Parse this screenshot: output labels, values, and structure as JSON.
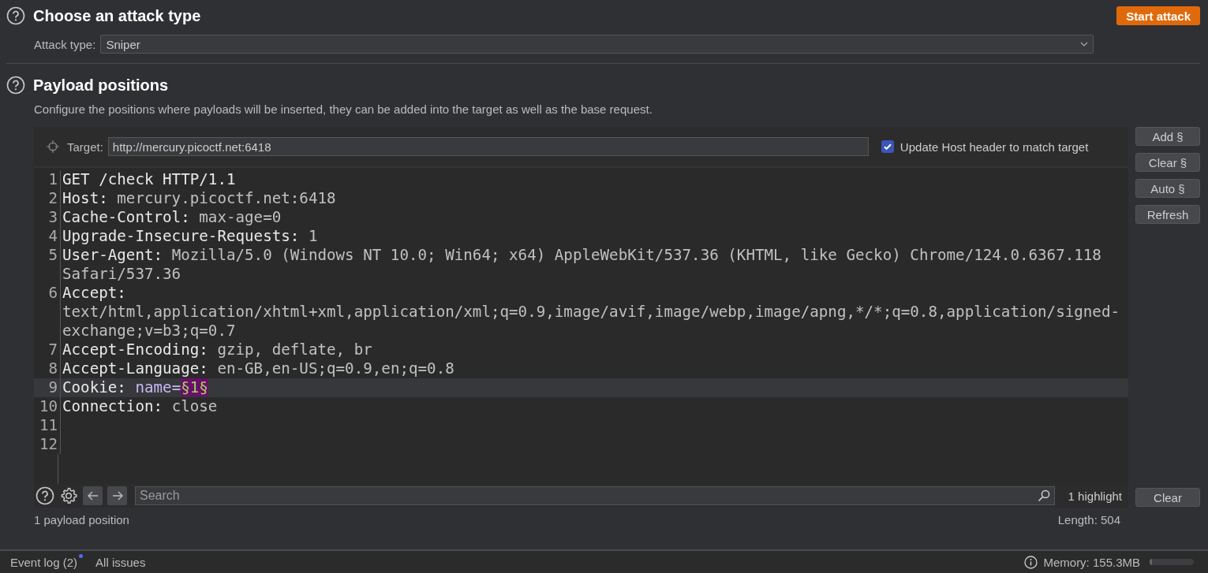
{
  "attack_section": {
    "title": "Choose an attack type",
    "start_button": "Start attack",
    "attack_type_label": "Attack type:",
    "attack_type_value": "Sniper"
  },
  "positions_section": {
    "title": "Payload positions",
    "description": "Configure the positions where payloads will be inserted, they can be added into the target as well as the base request.",
    "target_label": "Target:",
    "target_value": "http://mercury.picoctf.net:6418",
    "update_host": {
      "label": "Update Host header to match target",
      "checked": true
    },
    "side_buttons": [
      "Add §",
      "Clear §",
      "Auto §",
      "Refresh"
    ],
    "lines": [
      {
        "number": "1",
        "selected": false,
        "segments": [
          {
            "kind": "name",
            "text": "GET /check HTTP/1.1"
          }
        ]
      },
      {
        "number": "2",
        "selected": false,
        "segments": [
          {
            "kind": "name",
            "text": "Host: "
          },
          {
            "kind": "value",
            "text": "mercury.picoctf.net:6418"
          }
        ]
      },
      {
        "number": "3",
        "selected": false,
        "segments": [
          {
            "kind": "name",
            "text": "Cache-Control: "
          },
          {
            "kind": "value",
            "text": "max-age=0"
          }
        ]
      },
      {
        "number": "4",
        "selected": false,
        "segments": [
          {
            "kind": "name",
            "text": "Upgrade-Insecure-Requests: "
          },
          {
            "kind": "value",
            "text": "1"
          }
        ]
      },
      {
        "number": "5",
        "selected": false,
        "segments": [
          {
            "kind": "name",
            "text": "User-Agent: "
          },
          {
            "kind": "value",
            "text": "Mozilla/5.0 (Windows NT 10.0; Win64; x64) AppleWebKit/537.36 (KHTML, like Gecko) Chrome/124.0.6367.118 Safari/537.36"
          }
        ]
      },
      {
        "number": "6",
        "selected": false,
        "segments": [
          {
            "kind": "name",
            "text": "Accept: "
          },
          {
            "kind": "value",
            "text": "text/html,application/xhtml+xml,application/xml;q=0.9,image/avif,image/webp,image/apng,*/*;q=0.8,application/signed-exchange;v=b3;q=0.7"
          }
        ]
      },
      {
        "number": "7",
        "selected": false,
        "segments": [
          {
            "kind": "name",
            "text": "Accept-Encoding: "
          },
          {
            "kind": "value",
            "text": "gzip, deflate, br"
          }
        ]
      },
      {
        "number": "8",
        "selected": false,
        "segments": [
          {
            "kind": "name",
            "text": "Accept-Language: "
          },
          {
            "kind": "value",
            "text": "en-GB,en-US;q=0.9,en;q=0.8"
          }
        ]
      },
      {
        "number": "9",
        "selected": true,
        "segments": [
          {
            "kind": "name",
            "text": "Cookie: "
          },
          {
            "kind": "param",
            "text": "name="
          },
          {
            "kind": "payload",
            "text": "§1§"
          }
        ]
      },
      {
        "number": "10",
        "selected": false,
        "segments": [
          {
            "kind": "name",
            "text": "Connection: "
          },
          {
            "kind": "value",
            "text": "close"
          }
        ]
      },
      {
        "number": "11",
        "selected": false
      },
      {
        "number": "12",
        "selected": false
      }
    ],
    "search": {
      "placeholder": "Search",
      "matches": "1 highlight",
      "clear_button": "Clear"
    },
    "payload_count": "1 payload position",
    "length": "Length: 504"
  },
  "status_bar": {
    "event_log": "Event log (2)",
    "event_log_unread": true,
    "all_issues": "All issues",
    "memory": "Memory: 155.3MB",
    "memory_meter": {
      "level": 0.05
    }
  }
}
